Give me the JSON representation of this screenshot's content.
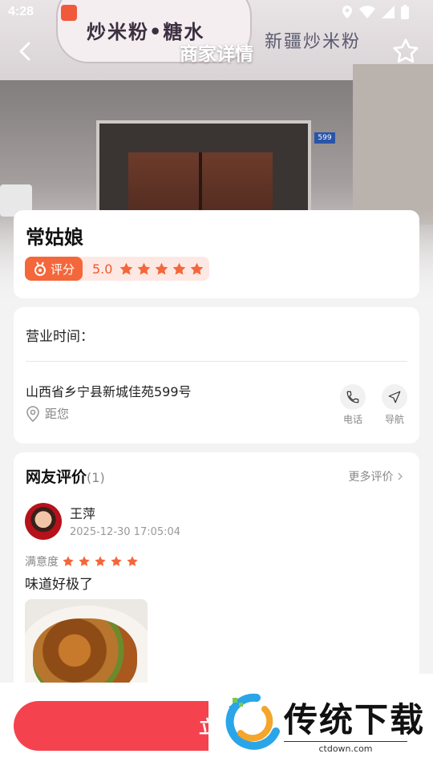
{
  "status_bar": {
    "time": "4:28"
  },
  "hero": {
    "sign_left": "炒米粉•糖水",
    "sign_right": "新疆炒米粉",
    "door_plate": "599"
  },
  "header": {
    "title": "商家详情"
  },
  "shop": {
    "name": "常姑娘",
    "rating_label": "评分",
    "rating_score": "5.0",
    "rating_stars": 5
  },
  "info": {
    "hours_label": "营业时间：",
    "address": "山西省乡宁县新城佳苑599号",
    "distance_label": "距您",
    "phone_label": "电话",
    "nav_label": "导航"
  },
  "reviews": {
    "heading": "网友评价",
    "count": "(1)",
    "more_label": "更多评价",
    "items": [
      {
        "name": "王萍",
        "time": "2025-12-30 17:05:04",
        "satisfaction_label": "满意度",
        "stars": 5,
        "text": "味道好极了"
      }
    ]
  },
  "cta": {
    "label": "立即"
  },
  "watermark": {
    "title": "传统下载",
    "url": "ctdown.com"
  },
  "colors": {
    "accent": "#f5424f",
    "star": "#f4673b",
    "rating_bg": "#fde8e4"
  },
  "icons": [
    "back-icon",
    "star-outline-icon",
    "medal-icon",
    "phone-icon",
    "navigate-icon",
    "location-icon",
    "chevron-right-icon"
  ]
}
